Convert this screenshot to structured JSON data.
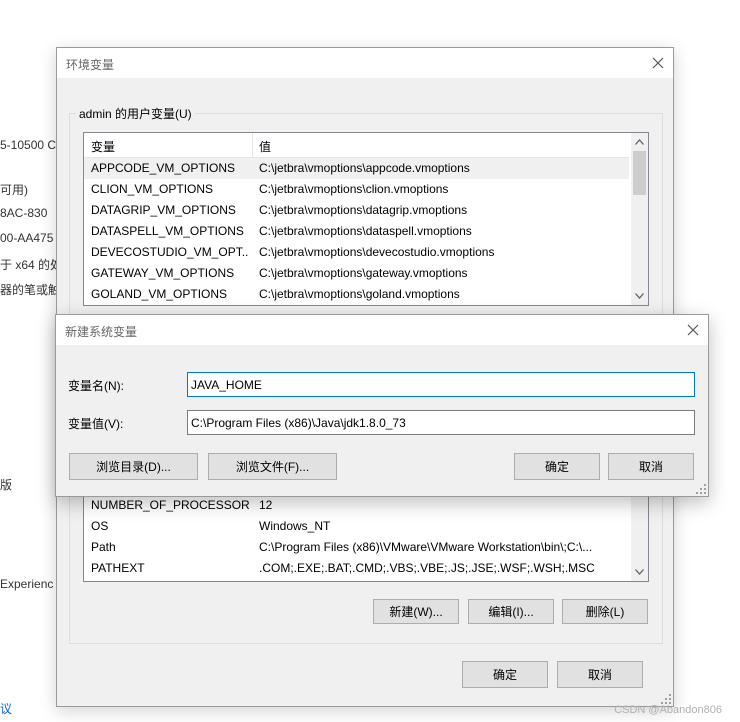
{
  "background": {
    "fragments": [
      "5-10500 C",
      "可用)",
      "8AC-830",
      "00-AA475",
      "于 x64 的处",
      "器的笔或触",
      "版",
      "Experienc",
      "议"
    ]
  },
  "env_dialog": {
    "title": "环境变量",
    "user_group_label": "admin 的用户变量(U)",
    "columns": {
      "name": "变量",
      "value": "值"
    },
    "user_vars": [
      {
        "name": "APPCODE_VM_OPTIONS",
        "value": "C:\\jetbra\\vmoptions\\appcode.vmoptions"
      },
      {
        "name": "CLION_VM_OPTIONS",
        "value": "C:\\jetbra\\vmoptions\\clion.vmoptions"
      },
      {
        "name": "DATAGRIP_VM_OPTIONS",
        "value": "C:\\jetbra\\vmoptions\\datagrip.vmoptions"
      },
      {
        "name": "DATASPELL_VM_OPTIONS",
        "value": "C:\\jetbra\\vmoptions\\dataspell.vmoptions"
      },
      {
        "name": "DEVECOSTUDIO_VM_OPT...",
        "value": "C:\\jetbra\\vmoptions\\devecostudio.vmoptions"
      },
      {
        "name": "GATEWAY_VM_OPTIONS",
        "value": "C:\\jetbra\\vmoptions\\gateway.vmoptions"
      },
      {
        "name": "GOLAND_VM_OPTIONS",
        "value": "C:\\jetbra\\vmoptions\\goland.vmoptions"
      }
    ],
    "system_vars": [
      {
        "name": "NUMBER_OF_PROCESSORS",
        "value": "12"
      },
      {
        "name": "OS",
        "value": "Windows_NT"
      },
      {
        "name": "Path",
        "value": "C:\\Program Files (x86)\\VMware\\VMware Workstation\\bin\\;C:\\..."
      },
      {
        "name": "PATHEXT",
        "value": ".COM;.EXE;.BAT;.CMD;.VBS;.VBE;.JS;.JSE;.WSF;.WSH;.MSC"
      }
    ],
    "system_buttons": {
      "new": "新建(W)...",
      "edit": "编辑(I)...",
      "delete": "删除(L)"
    },
    "ok": "确定",
    "cancel": "取消"
  },
  "new_var_dialog": {
    "title": "新建系统变量",
    "name_label": "变量名(N):",
    "name_value": "JAVA_HOME",
    "value_label": "变量值(V):",
    "value_value": "C:\\Program Files (x86)\\Java\\jdk1.8.0_73",
    "browse_dir": "浏览目录(D)...",
    "browse_file": "浏览文件(F)...",
    "ok": "确定",
    "cancel": "取消"
  },
  "watermark": "CSDN @Abandon806",
  "colors": {
    "dialog_bg": "#f0f0f0",
    "focus_border": "#0078d7",
    "link": "#0066cc"
  }
}
